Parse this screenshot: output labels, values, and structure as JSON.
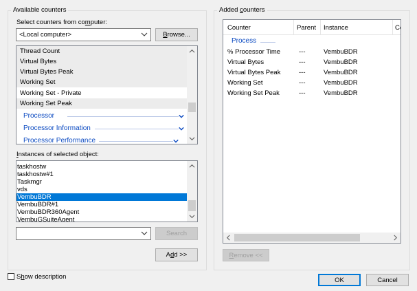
{
  "available": {
    "legend": "Available counters",
    "select_label_pre": "Select counters from co",
    "select_label_u": "m",
    "select_label_post": "puter:",
    "computer_value": "<Local computer>",
    "browse_pre": "",
    "browse_u": "B",
    "browse_post": "rowse...",
    "counters": [
      "Thread Count",
      "Virtual Bytes",
      "Virtual Bytes Peak",
      "Working Set",
      "Working Set - Private",
      "Working Set Peak"
    ],
    "categories": [
      "Processor",
      "Processor Information",
      "Processor Performance"
    ],
    "instances_label_u": "I",
    "instances_label_post": "nstances of selected object:",
    "instances": [
      "taskhostw",
      "taskhostw#1",
      "Taskmgr",
      "vds",
      "VembuBDR",
      "VembuBDR#1",
      "VembuBDR360Agent",
      "VembuGSuiteAgent"
    ],
    "selected_instance_index": 4,
    "search_value": "",
    "search_label": "Search",
    "add_pre": "A",
    "add_u": "d",
    "add_post": "d >>"
  },
  "added": {
    "legend_pre": "Added ",
    "legend_u": "c",
    "legend_post": "ounters",
    "columns": [
      "Counter",
      "Parent",
      "Instance",
      "Co"
    ],
    "group": "Process",
    "rows": [
      {
        "counter": "% Processor Time",
        "parent": "---",
        "instance": "VembuBDR"
      },
      {
        "counter": "Virtual Bytes",
        "parent": "---",
        "instance": "VembuBDR"
      },
      {
        "counter": "Virtual Bytes Peak",
        "parent": "---",
        "instance": "VembuBDR"
      },
      {
        "counter": "Working Set",
        "parent": "---",
        "instance": "VembuBDR"
      },
      {
        "counter": "Working Set Peak",
        "parent": "---",
        "instance": "VembuBDR"
      }
    ],
    "remove_u": "R",
    "remove_post": "emove <<"
  },
  "footer": {
    "show_desc_pre": "S",
    "show_desc_u": "h",
    "show_desc_post": "ow description",
    "ok_label": "OK",
    "cancel_label": "Cancel"
  },
  "colors": {
    "accent": "#0078d7",
    "category": "#0a49c1"
  }
}
